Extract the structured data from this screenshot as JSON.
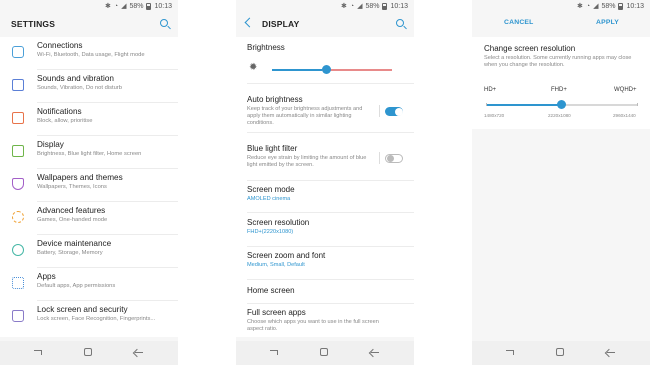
{
  "status": {
    "p1": {
      "battery": "58%",
      "time": "10:13"
    },
    "p2": {
      "battery": "58%",
      "time": "10:13"
    },
    "p3": {
      "battery": "58%",
      "time": "10:13"
    }
  },
  "settings": {
    "title": "SETTINGS",
    "items": [
      {
        "title": "Connections",
        "subtitle": "Wi-Fi, Bluetooth, Data usage, Flight mode",
        "icon": "connections-icon",
        "color": "#4a9fd8"
      },
      {
        "title": "Sounds and vibration",
        "subtitle": "Sounds, Vibration, Do not disturb",
        "icon": "speaker-icon",
        "color": "#5b7fd6"
      },
      {
        "title": "Notifications",
        "subtitle": "Block, allow, prioritise",
        "icon": "notifications-icon",
        "color": "#e8734a"
      },
      {
        "title": "Display",
        "subtitle": "Brightness, Blue light filter, Home screen",
        "icon": "display-icon",
        "color": "#6fb54a"
      },
      {
        "title": "Wallpapers and themes",
        "subtitle": "Wallpapers, Themes, Icons",
        "icon": "brush-icon",
        "color": "#a35fc8"
      },
      {
        "title": "Advanced features",
        "subtitle": "Games, One-handed mode",
        "icon": "gear-plus-icon",
        "color": "#f0a236"
      },
      {
        "title": "Device maintenance",
        "subtitle": "Battery, Storage, Memory",
        "icon": "maintenance-icon",
        "color": "#45b7a6"
      },
      {
        "title": "Apps",
        "subtitle": "Default apps, App permissions",
        "icon": "apps-icon",
        "color": "#4a8fd8"
      },
      {
        "title": "Lock screen and security",
        "subtitle": "Lock screen, Face Recognition, Fingerprints...",
        "icon": "lock-icon",
        "color": "#8a7bc8"
      }
    ]
  },
  "display": {
    "title": "DISPLAY",
    "brightness": {
      "label": "Brightness",
      "level": 0.45
    },
    "auto_brightness": {
      "title": "Auto brightness",
      "subtitle": "Keep track of your brightness adjustments and apply them automatically in similar lighting conditions.",
      "on": true
    },
    "blue_light": {
      "title": "Blue light filter",
      "subtitle": "Reduce eye strain by limiting the amount of blue light emitted by the screen.",
      "on": false
    },
    "screen_mode": {
      "title": "Screen mode",
      "value": "AMOLED cinema"
    },
    "screen_resolution": {
      "title": "Screen resolution",
      "value": "FHD+(2220x1080)"
    },
    "zoom_font": {
      "title": "Screen zoom and font",
      "value": "Medium, Small, Default"
    },
    "home_screen": {
      "title": "Home screen"
    },
    "full_screen_apps": {
      "title": "Full screen apps",
      "subtitle": "Choose which apps you want to use in the full screen aspect ratio."
    }
  },
  "resolution": {
    "cancel": "CANCEL",
    "apply": "APPLY",
    "title": "Change screen resolution",
    "description": "Select a resolution. Some currently running apps may close when you change the resolution.",
    "options": [
      {
        "label": "HD+",
        "value": "1480x720"
      },
      {
        "label": "FHD+",
        "value": "2220x1080"
      },
      {
        "label": "WQHD+",
        "value": "2960x1440"
      }
    ],
    "selected_index": 1
  },
  "colors": {
    "accent": "#2e95cf",
    "slider_warm": "#e88a8a"
  }
}
